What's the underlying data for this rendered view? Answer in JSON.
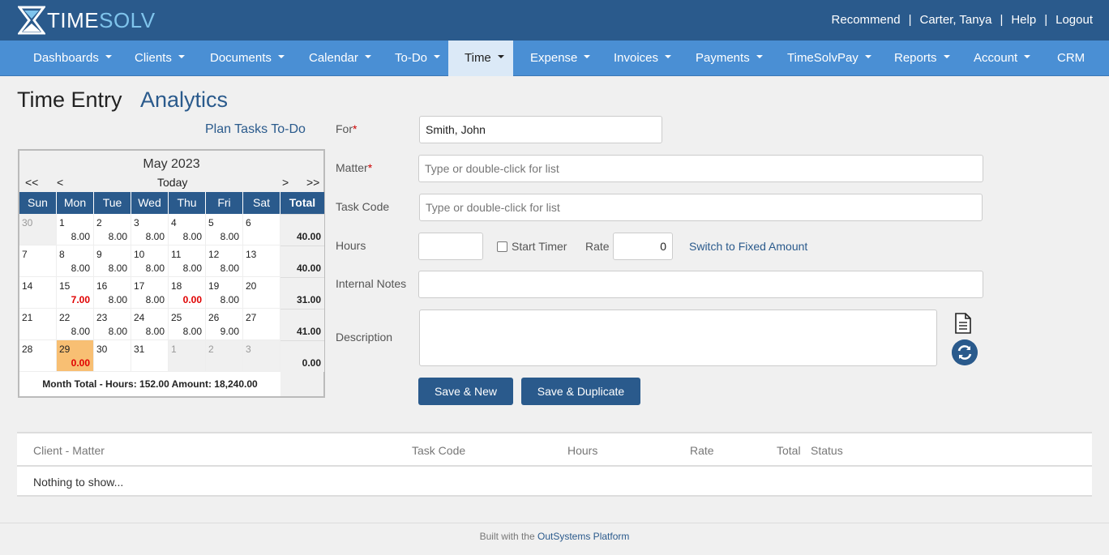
{
  "header": {
    "logo_time": "TIME",
    "logo_solv": "SOLV",
    "links": {
      "recommend": "Recommend",
      "user": "Carter, Tanya",
      "help": "Help",
      "logout": "Logout",
      "sep": "|"
    }
  },
  "nav": {
    "dashboards": "Dashboards",
    "clients": "Clients",
    "documents": "Documents",
    "calendar": "Calendar",
    "todo": "To-Do",
    "time": "Time",
    "expense": "Expense",
    "invoices": "Invoices",
    "payments": "Payments",
    "timesolvpay": "TimeSolvPay",
    "reports": "Reports",
    "account": "Account",
    "crm": "CRM"
  },
  "page": {
    "title": "Time Entry",
    "analytics": "Analytics",
    "plan_link": "Plan Tasks To-Do"
  },
  "calendar": {
    "month": "May 2023",
    "prev_year": "<<",
    "prev_month": "<",
    "today": "Today",
    "next_month": ">",
    "next_year": ">>",
    "headers": [
      "Sun",
      "Mon",
      "Tue",
      "Wed",
      "Thu",
      "Fri",
      "Sat",
      "Total"
    ],
    "weeks": [
      {
        "days": [
          [
            "30",
            ""
          ],
          [
            "1",
            "8.00"
          ],
          [
            "2",
            "8.00"
          ],
          [
            "3",
            "8.00"
          ],
          [
            "4",
            "8.00"
          ],
          [
            "5",
            "8.00"
          ],
          [
            "6",
            ""
          ]
        ],
        "total": "40.00"
      },
      {
        "days": [
          [
            "7",
            ""
          ],
          [
            "8",
            "8.00"
          ],
          [
            "9",
            "8.00"
          ],
          [
            "10",
            "8.00"
          ],
          [
            "11",
            "8.00"
          ],
          [
            "12",
            "8.00"
          ],
          [
            "13",
            ""
          ]
        ],
        "total": "40.00"
      },
      {
        "days": [
          [
            "14",
            ""
          ],
          [
            "15",
            "7.00"
          ],
          [
            "16",
            "8.00"
          ],
          [
            "17",
            "8.00"
          ],
          [
            "18",
            "0.00"
          ],
          [
            "19",
            "8.00"
          ],
          [
            "20",
            ""
          ]
        ],
        "total": "31.00"
      },
      {
        "days": [
          [
            "21",
            ""
          ],
          [
            "22",
            "8.00"
          ],
          [
            "23",
            "8.00"
          ],
          [
            "24",
            "8.00"
          ],
          [
            "25",
            "8.00"
          ],
          [
            "26",
            "9.00"
          ],
          [
            "27",
            ""
          ]
        ],
        "total": "41.00"
      },
      {
        "days": [
          [
            "28",
            ""
          ],
          [
            "29",
            "0.00"
          ],
          [
            "30",
            ""
          ],
          [
            "31",
            ""
          ],
          [
            "1",
            ""
          ],
          [
            "2",
            ""
          ],
          [
            "3",
            ""
          ]
        ],
        "total": "0.00"
      }
    ],
    "footer": "Month Total - Hours: 152.00   Amount: 18,240.00"
  },
  "form": {
    "for_label": "For",
    "for_value": "Smith, John",
    "matter_label": "Matter",
    "matter_placeholder": "Type or double-click for list",
    "task_label": "Task Code",
    "task_placeholder": "Type or double-click for list",
    "hours_label": "Hours",
    "hours_value": "",
    "start_timer": "Start Timer",
    "rate_label": "Rate",
    "rate_value": "0",
    "switch_link": "Switch to Fixed Amount",
    "notes_label": "Internal Notes",
    "notes_value": "",
    "desc_label": "Description",
    "required_mark": "*",
    "save_new": "Save & New",
    "save_dup": "Save & Duplicate"
  },
  "grid": {
    "headers": {
      "client": "Client - Matter",
      "task": "Task Code",
      "hours": "Hours",
      "rate": "Rate",
      "total": "Total",
      "status": "Status"
    },
    "empty": "Nothing to show..."
  },
  "footer": {
    "prefix": "Built with the",
    "link": "OutSystems Platform"
  },
  "colors": {
    "header": "#2a5a8c",
    "nav": "#4a8fd4",
    "today": "#f8bf73",
    "red": "#e00000"
  }
}
